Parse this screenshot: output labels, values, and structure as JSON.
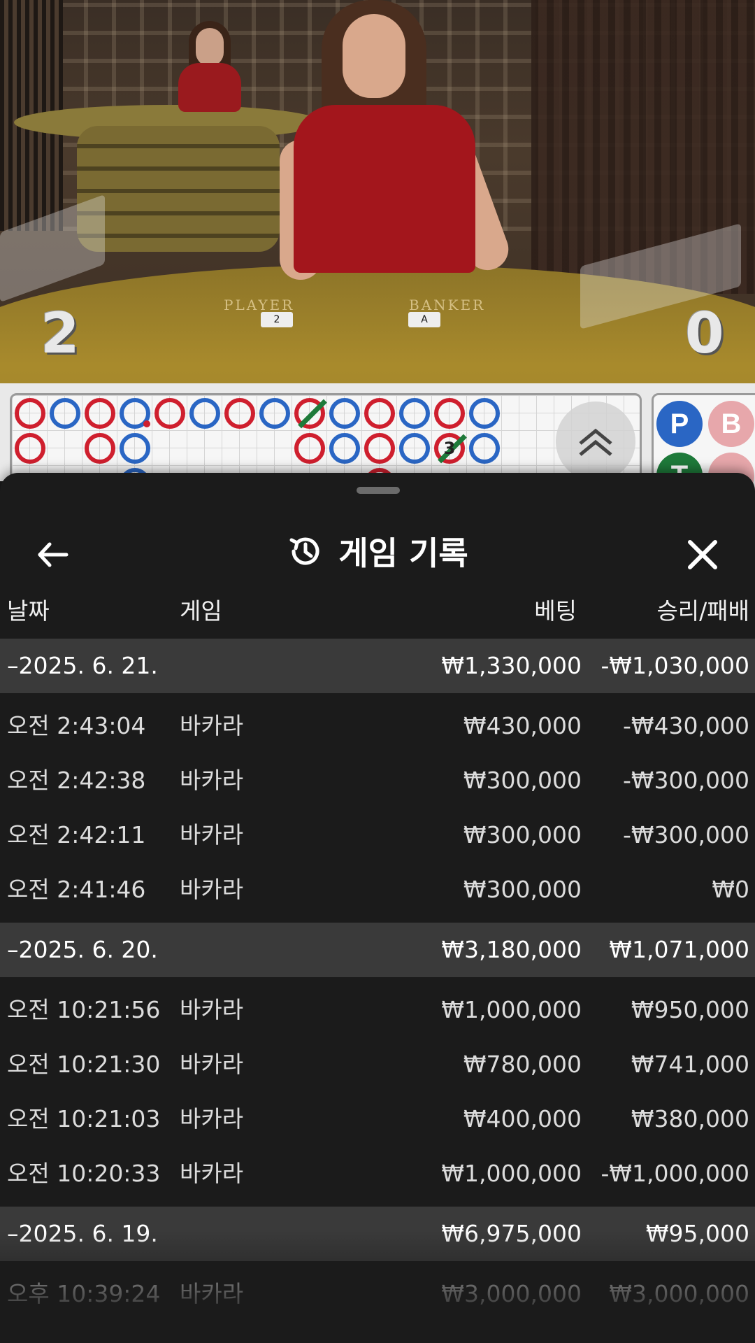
{
  "video": {
    "felt_player_label": "PLAYER",
    "felt_banker_label": "BANKER",
    "player_score": "2",
    "banker_score": "0",
    "player_card": "2",
    "banker_card": "A"
  },
  "roadmap": {
    "side_panel": {
      "p": "P",
      "b": "B",
      "t": "T"
    },
    "bead_number": "3"
  },
  "sheet": {
    "title": "게임 기록",
    "columns": {
      "date": "날짜",
      "game": "게임",
      "bet": "베팅",
      "winloss": "승리/패배"
    },
    "groups": [
      {
        "date": "–2025. 6. 21.",
        "bet": "₩1,330,000",
        "winloss": "-₩1,030,000",
        "items": [
          {
            "time": "오전 2:43:04",
            "game": "바카라",
            "bet": "₩430,000",
            "winloss": "-₩430,000"
          },
          {
            "time": "오전 2:42:38",
            "game": "바카라",
            "bet": "₩300,000",
            "winloss": "-₩300,000"
          },
          {
            "time": "오전 2:42:11",
            "game": "바카라",
            "bet": "₩300,000",
            "winloss": "-₩300,000"
          },
          {
            "time": "오전 2:41:46",
            "game": "바카라",
            "bet": "₩300,000",
            "winloss": "₩0"
          }
        ]
      },
      {
        "date": "–2025. 6. 20.",
        "bet": "₩3,180,000",
        "winloss": "₩1,071,000",
        "items": [
          {
            "time": "오전 10:21:56",
            "game": "바카라",
            "bet": "₩1,000,000",
            "winloss": "₩950,000"
          },
          {
            "time": "오전 10:21:30",
            "game": "바카라",
            "bet": "₩780,000",
            "winloss": "₩741,000"
          },
          {
            "time": "오전 10:21:03",
            "game": "바카라",
            "bet": "₩400,000",
            "winloss": "₩380,000"
          },
          {
            "time": "오전 10:20:33",
            "game": "바카라",
            "bet": "₩1,000,000",
            "winloss": "-₩1,000,000"
          }
        ]
      },
      {
        "date": "–2025. 6. 19.",
        "bet": "₩6,975,000",
        "winloss": "₩95,000",
        "items": [
          {
            "time": "오후 10:39:24",
            "game": "바카라",
            "bet": "₩3,000,000",
            "winloss": "₩3,000,000"
          }
        ]
      }
    ]
  },
  "colors": {
    "sheet_bg": "#1b1b1b",
    "group_bg": "#3a3a3a",
    "bead_red": "#cf1f2e",
    "bead_blue": "#2a66c4",
    "tie_green": "#1e7a3a"
  },
  "icons": {
    "back": "arrow-left-icon",
    "history": "history-clock-icon",
    "close": "close-icon",
    "expand": "double-chevron-up-icon"
  }
}
